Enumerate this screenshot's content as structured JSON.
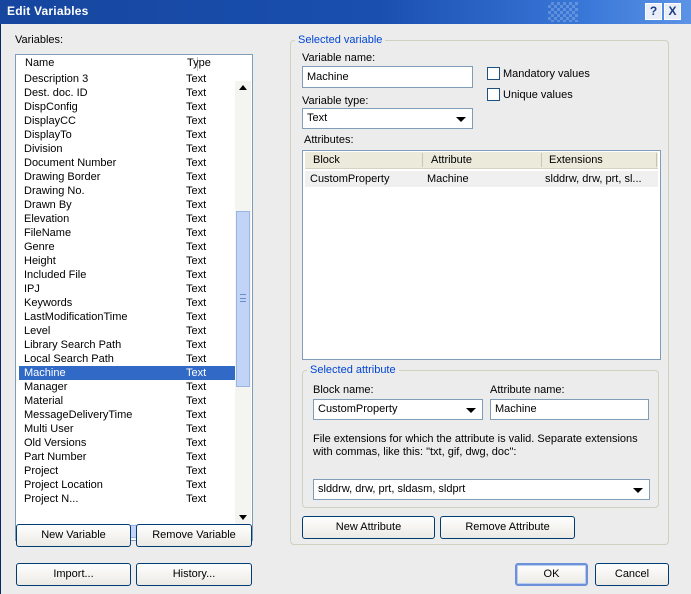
{
  "window": {
    "title": "Edit Variables",
    "help_glyph": "?",
    "close_glyph": "X"
  },
  "variables": {
    "label": "Variables:",
    "columns": {
      "name": "Name",
      "type": "Type"
    },
    "rows": [
      {
        "name": "Description 3",
        "type": "Text"
      },
      {
        "name": "Dest. doc. ID",
        "type": "Text"
      },
      {
        "name": "DispConfig",
        "type": "Text"
      },
      {
        "name": "DisplayCC",
        "type": "Text"
      },
      {
        "name": "DisplayTo",
        "type": "Text"
      },
      {
        "name": "Division",
        "type": "Text"
      },
      {
        "name": "Document Number",
        "type": "Text"
      },
      {
        "name": "Drawing Border",
        "type": "Text"
      },
      {
        "name": "Drawing No.",
        "type": "Text"
      },
      {
        "name": "Drawn By",
        "type": "Text"
      },
      {
        "name": "Elevation",
        "type": "Text"
      },
      {
        "name": "FileName",
        "type": "Text"
      },
      {
        "name": "Genre",
        "type": "Text"
      },
      {
        "name": "Height",
        "type": "Text"
      },
      {
        "name": "Included File",
        "type": "Text"
      },
      {
        "name": "IPJ",
        "type": "Text"
      },
      {
        "name": "Keywords",
        "type": "Text"
      },
      {
        "name": "LastModificationTime",
        "type": "Text"
      },
      {
        "name": "Level",
        "type": "Text"
      },
      {
        "name": "Library Search Path",
        "type": "Text"
      },
      {
        "name": "Local Search Path",
        "type": "Text"
      },
      {
        "name": "Machine",
        "type": "Text",
        "selected": true
      },
      {
        "name": "Manager",
        "type": "Text"
      },
      {
        "name": "Material",
        "type": "Text"
      },
      {
        "name": "MessageDeliveryTime",
        "type": "Text"
      },
      {
        "name": "Multi User",
        "type": "Text"
      },
      {
        "name": "Old Versions",
        "type": "Text"
      },
      {
        "name": "Part Number",
        "type": "Text"
      },
      {
        "name": "Project",
        "type": "Text"
      },
      {
        "name": "Project Location",
        "type": "Text"
      },
      {
        "name": "Project N...",
        "type": "Text"
      }
    ],
    "new_button": "New Variable",
    "remove_button": "Remove Variable",
    "import_button": "Import...",
    "history_button": "History..."
  },
  "selected_variable": {
    "group_title": "Selected variable",
    "name_label": "Variable name:",
    "name_value": "Machine",
    "type_label": "Variable type:",
    "type_value": "Text",
    "mandatory_label": "Mandatory values",
    "mandatory_checked": false,
    "unique_label": "Unique values",
    "unique_checked": false,
    "attributes_label": "Attributes:",
    "attr_columns": {
      "block": "Block",
      "attribute": "Attribute",
      "extensions": "Extensions"
    },
    "attr_rows": [
      {
        "block": "CustomProperty",
        "attribute": "Machine",
        "extensions": "slddrw, drw, prt, sl..."
      }
    ]
  },
  "selected_attribute": {
    "group_title": "Selected attribute",
    "block_label": "Block name:",
    "block_value": "CustomProperty",
    "attr_label": "Attribute name:",
    "attr_value": "Machine",
    "ext_help_line1": "File extensions for which the attribute is valid. Separate extensions",
    "ext_help_line2": "with commas, like this: \"txt, gif, dwg, doc\":",
    "ext_value": "slddrw, drw, prt, sldasm, sldprt",
    "new_attribute_button": "New Attribute",
    "remove_attribute_button": "Remove Attribute"
  },
  "footer": {
    "ok_button": "OK",
    "cancel_button": "Cancel"
  },
  "colors": {
    "title_bar": "#16469e",
    "selection": "#3169c6",
    "group_title": "#0046d5",
    "dialog_bg": "#ececec"
  }
}
